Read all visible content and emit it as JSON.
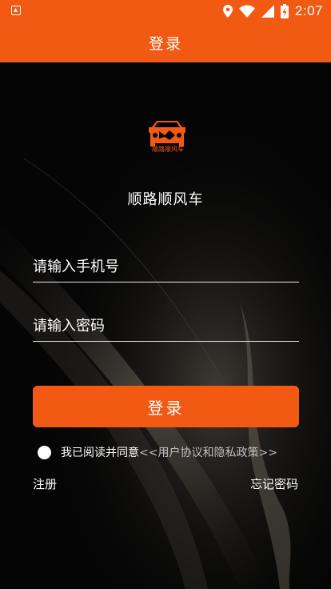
{
  "status_bar": {
    "time": "2:07"
  },
  "app_bar": {
    "title": "登录"
  },
  "logo": {
    "text": "顺路顺风车"
  },
  "app_name": "顺路顺风车",
  "form": {
    "phone_placeholder": "请输入手机号",
    "password_placeholder": "请输入密码",
    "login_button": "登录"
  },
  "agreement": {
    "prefix": "我已阅读并同意",
    "link": "<<用户协议和隐私政策>>"
  },
  "links": {
    "register": "注册",
    "forgot_password": "忘记密码"
  },
  "colors": {
    "brand": "#f25a14",
    "background": "#050505"
  }
}
